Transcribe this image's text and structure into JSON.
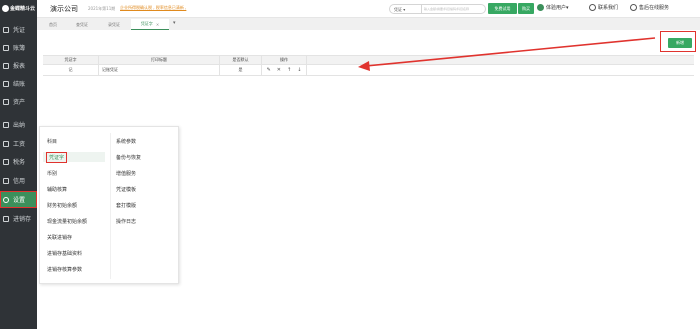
{
  "sidebar": {
    "logo_text": "金蝶精斗云",
    "items": [
      {
        "label": "凭证",
        "icon": "voucher-icon"
      },
      {
        "label": "账簿",
        "icon": "ledger-icon"
      },
      {
        "label": "报表",
        "icon": "report-icon"
      },
      {
        "label": "结账",
        "icon": "close-account-icon"
      },
      {
        "label": "资产",
        "icon": "asset-icon"
      },
      {
        "label": "出纳",
        "icon": "cashier-icon"
      },
      {
        "label": "工资",
        "icon": "salary-icon"
      },
      {
        "label": "税务",
        "icon": "tax-icon"
      },
      {
        "label": "信用",
        "icon": "credit-icon"
      },
      {
        "label": "设置",
        "icon": "gear-icon"
      },
      {
        "label": "进销存",
        "icon": "inventory-icon"
      }
    ],
    "active_index": 9
  },
  "topbar": {
    "company": "演示公司",
    "period": "2021年第11期",
    "notice": "企业所得税确认税 , 税率信息已清新 ,",
    "search_type": "凭证",
    "search_placeholder": "输入金额/摘要/科目编码/科目名称",
    "trial_label": "免费试用",
    "buy_label": "购买",
    "user_label": "体验用户",
    "contact_label": "联系我们",
    "service_label": "售后在线服务"
  },
  "tabs": [
    {
      "label": "首页"
    },
    {
      "label": "查凭证"
    },
    {
      "label": "录凭证"
    },
    {
      "label": "凭证字",
      "active": true
    }
  ],
  "main": {
    "new_button": "新增",
    "table": {
      "headers": [
        "凭证字",
        "打印标题",
        "是否默认",
        "操作"
      ],
      "rows": [
        {
          "word": "记",
          "title": "记账凭证",
          "default": "是"
        }
      ]
    }
  },
  "settings_menu": {
    "left": [
      "科目",
      "凭证字",
      "币别",
      "辅助核算",
      "财务初始余额",
      "现金流量初始余额",
      "关联进销存",
      "进销存基础资料",
      "进销存核算参数"
    ],
    "right": [
      "系统参数",
      "备份与恢复",
      "增值服务",
      "凭证模板",
      "套打模版",
      "操作日志"
    ],
    "highlight": "凭证字"
  },
  "colors": {
    "accent": "#37a862",
    "sidebar_bg": "#2f3337",
    "annotation": "#e0332e"
  }
}
